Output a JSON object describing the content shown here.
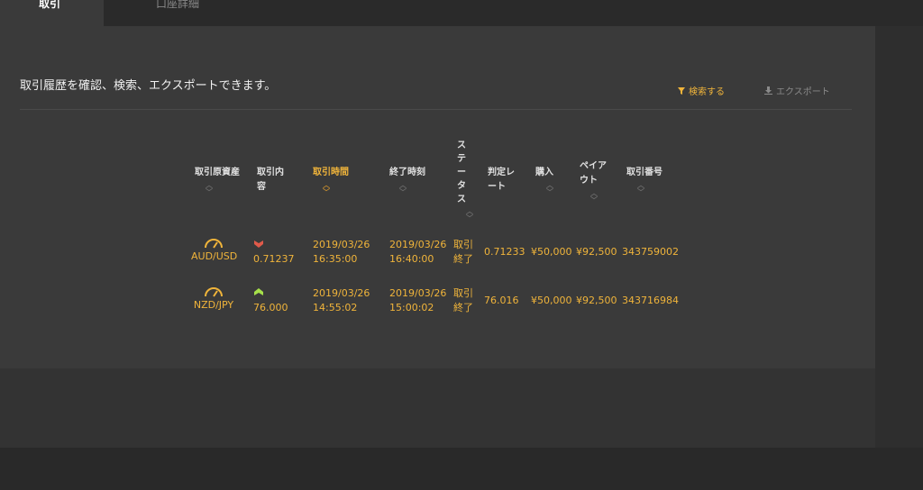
{
  "tabs": [
    {
      "label": "取引",
      "active": true
    },
    {
      "label": "口座詳細",
      "active": false
    }
  ],
  "description": "取引履歴を確認、検索、エクスポートできます。",
  "actions": {
    "search_label": "検索する",
    "export_label": "エクスポート"
  },
  "table": {
    "headers": {
      "asset": "取引原資産",
      "content_1": "取引内",
      "content_2": "容",
      "trade_time": "取引時間",
      "end_time": "終了時刻",
      "status_1": "ス",
      "status_2": "テ",
      "status_3": "ー",
      "status_4": "タ",
      "status_5": "ス",
      "rate_1": "判定レ",
      "rate_2": "ート",
      "purchase": "購入",
      "payout_1": "ペイア",
      "payout_2": "ウト",
      "trade_no": "取引番号"
    },
    "rows": [
      {
        "asset": "AUD/USD",
        "direction": "down",
        "content_value": "0.71237",
        "trade_date": "2019/03/26",
        "trade_time": "16:35:00",
        "end_date": "2019/03/26",
        "end_time": "16:40:00",
        "status_1": "取引",
        "status_2": "終了",
        "rate": "0.71233",
        "purchase": "¥50,000",
        "payout": "¥92,500",
        "trade_no": "343759002"
      },
      {
        "asset": "NZD/JPY",
        "direction": "up",
        "content_value": "76.000",
        "trade_date": "2019/03/26",
        "trade_time": "14:55:02",
        "end_date": "2019/03/26",
        "end_time": "15:00:02",
        "status_1": "取引",
        "status_2": "終了",
        "rate": "76.016",
        "purchase": "¥50,000",
        "payout": "¥92,500",
        "trade_no": "343716984"
      }
    ]
  },
  "colors": {
    "accent": "#f0b43a",
    "down": "#e05a4a",
    "up": "#a6e04a"
  }
}
